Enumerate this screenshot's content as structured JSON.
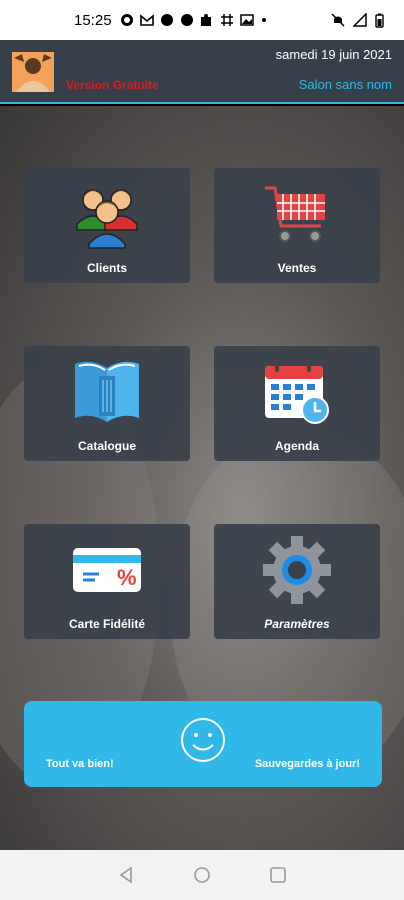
{
  "status_bar": {
    "time": "15:25",
    "indicators": [
      "whatsapp-icon",
      "gmail-icon",
      "dot-icon",
      "dot-icon",
      "puzzle-icon",
      "slack-icon",
      "image-icon",
      "dot-icon"
    ],
    "right": [
      "mute-icon",
      "no-signal-icon",
      "battery-icon"
    ]
  },
  "header": {
    "version": "Version Gratuite",
    "date": "samedi 19 juin 2021",
    "salon": "Salon sans nom"
  },
  "tiles": [
    {
      "label": "Clients",
      "icon": "clients-icon"
    },
    {
      "label": "Ventes",
      "icon": "cart-icon"
    },
    {
      "label": "Catalogue",
      "icon": "book-icon"
    },
    {
      "label": "Agenda",
      "icon": "calendar-icon"
    },
    {
      "label": "Carte Fidélité",
      "icon": "card-icon"
    },
    {
      "label": "Paramètres",
      "icon": "gear-icon"
    }
  ],
  "status_panel": {
    "left": "Tout va bien!",
    "right": "Sauvegardes à jour!"
  },
  "colors": {
    "accent": "#2fb8e8",
    "header_bg": "#37404a",
    "version_red": "#e01a1a"
  }
}
